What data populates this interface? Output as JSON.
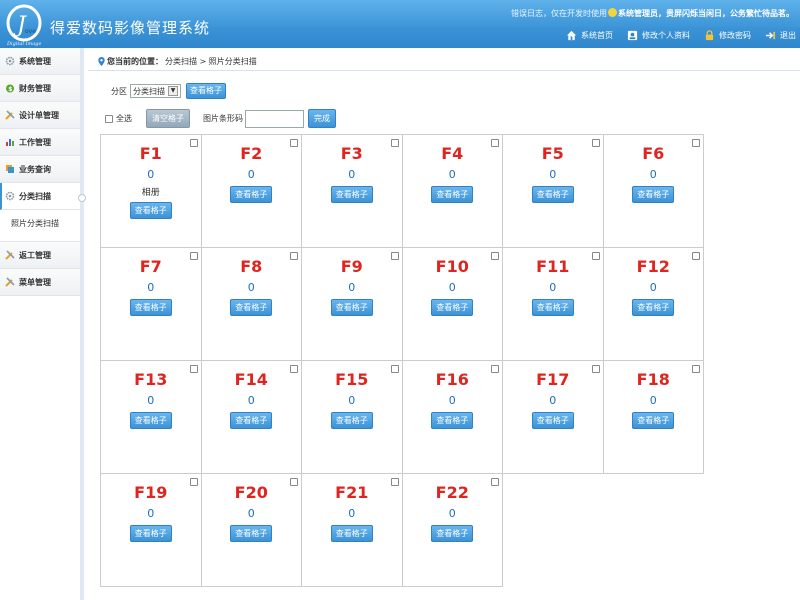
{
  "header": {
    "logo_text": "Digital Image",
    "logo_mark": "Love",
    "title": "得爱数码影像管理系统",
    "welcome_prefix": "错误日志，仅在开发时使用",
    "welcome_user": "系统管理员，贵屏闪烁当闲日，公务繁忙待品茗。",
    "links": [
      {
        "label": "系统首页",
        "icon": "home-icon"
      },
      {
        "label": "修改个人资料",
        "icon": "profile-icon"
      },
      {
        "label": "修改密码",
        "icon": "lock-icon"
      },
      {
        "label": "退出",
        "icon": "exit-icon"
      }
    ]
  },
  "sidebar": {
    "items": [
      {
        "label": "系统管理",
        "icon": "gear-icon"
      },
      {
        "label": "财务管理",
        "icon": "money-icon"
      },
      {
        "label": "设计单管理",
        "icon": "tools-icon"
      },
      {
        "label": "工作管理",
        "icon": "chart-icon"
      },
      {
        "label": "业务查询",
        "icon": "search-icon"
      },
      {
        "label": "分类扫描",
        "icon": "gear-icon"
      },
      {
        "label": "返工管理",
        "icon": "tools-icon"
      },
      {
        "label": "菜单管理",
        "icon": "tools-icon"
      }
    ],
    "subitem": "照片分类扫描"
  },
  "breadcrumb": {
    "label": "您当前的位置：",
    "path": "分类扫描 > 照片分类扫描"
  },
  "toolbar": {
    "partition_label": "分区",
    "partition_value": "分类扫描",
    "view_button": "查看格子",
    "select_all_label": "全选",
    "clear_button": "清空格子",
    "barcode_label": "图片条形码",
    "barcode_value": "",
    "done_button": "完成"
  },
  "grid": {
    "view_button": "查看格子",
    "cells": [
      {
        "name": "F1",
        "count": "0",
        "tag": "相册"
      },
      {
        "name": "F2",
        "count": "0",
        "tag": ""
      },
      {
        "name": "F3",
        "count": "0",
        "tag": ""
      },
      {
        "name": "F4",
        "count": "0",
        "tag": ""
      },
      {
        "name": "F5",
        "count": "0",
        "tag": ""
      },
      {
        "name": "F6",
        "count": "0",
        "tag": ""
      },
      {
        "name": "F7",
        "count": "0",
        "tag": ""
      },
      {
        "name": "F8",
        "count": "0",
        "tag": ""
      },
      {
        "name": "F9",
        "count": "0",
        "tag": ""
      },
      {
        "name": "F10",
        "count": "0",
        "tag": ""
      },
      {
        "name": "F11",
        "count": "0",
        "tag": ""
      },
      {
        "name": "F12",
        "count": "0",
        "tag": ""
      },
      {
        "name": "F13",
        "count": "0",
        "tag": ""
      },
      {
        "name": "F14",
        "count": "0",
        "tag": ""
      },
      {
        "name": "F15",
        "count": "0",
        "tag": ""
      },
      {
        "name": "F16",
        "count": "0",
        "tag": ""
      },
      {
        "name": "F17",
        "count": "0",
        "tag": ""
      },
      {
        "name": "F18",
        "count": "0",
        "tag": ""
      },
      {
        "name": "F19",
        "count": "0",
        "tag": ""
      },
      {
        "name": "F20",
        "count": "0",
        "tag": ""
      },
      {
        "name": "F21",
        "count": "0",
        "tag": ""
      },
      {
        "name": "F22",
        "count": "0",
        "tag": ""
      }
    ]
  },
  "colors": {
    "accent": "#3b93d6",
    "cell_name": "#e0241f",
    "cell_count": "#1f6fb8"
  }
}
